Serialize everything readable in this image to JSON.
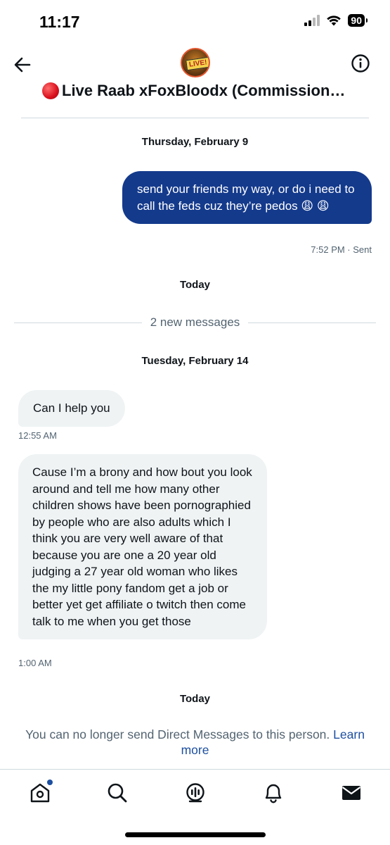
{
  "status_bar": {
    "time": "11:17",
    "battery": "90"
  },
  "header": {
    "avatar_text": "LIVE!",
    "title": "Live Raab xFoxBloodx (Commissions…"
  },
  "conversation": {
    "date_1": "Thursday, February 9",
    "sent_message": "send your friends my way, or do i need to call the feds cuz they’re pedos 😩 😩",
    "sent_meta": "7:52 PM · Sent",
    "today_1": "Today",
    "new_messages": "2 new messages",
    "date_2": "Tuesday, February 14",
    "recv_message_1": "Can I help you",
    "recv_meta_1": "12:55 AM",
    "recv_message_2": "Cause I’m a brony and how bout you look around and tell me how many other children shows have been pornographied by people who are also adults which I think you are very well aware of that because you are one a 20 year old judging a 27 year old woman who likes the my little pony fandom get a job or better yet get affiliate o twitch then come talk to me when you get those",
    "recv_meta_2": "1:00 AM",
    "today_2": "Today"
  },
  "notice": {
    "text": "You can no longer send Direct Messages to this person.",
    "link": "Learn more"
  },
  "tabbar": {
    "icons": [
      "home-icon",
      "search-icon",
      "spaces-icon",
      "notifications-icon",
      "messages-icon"
    ]
  },
  "colors": {
    "sent_bubble": "#143a8c",
    "recv_bubble": "#eff3f4",
    "link": "#1d4fa0",
    "secondary_text": "#536471"
  }
}
